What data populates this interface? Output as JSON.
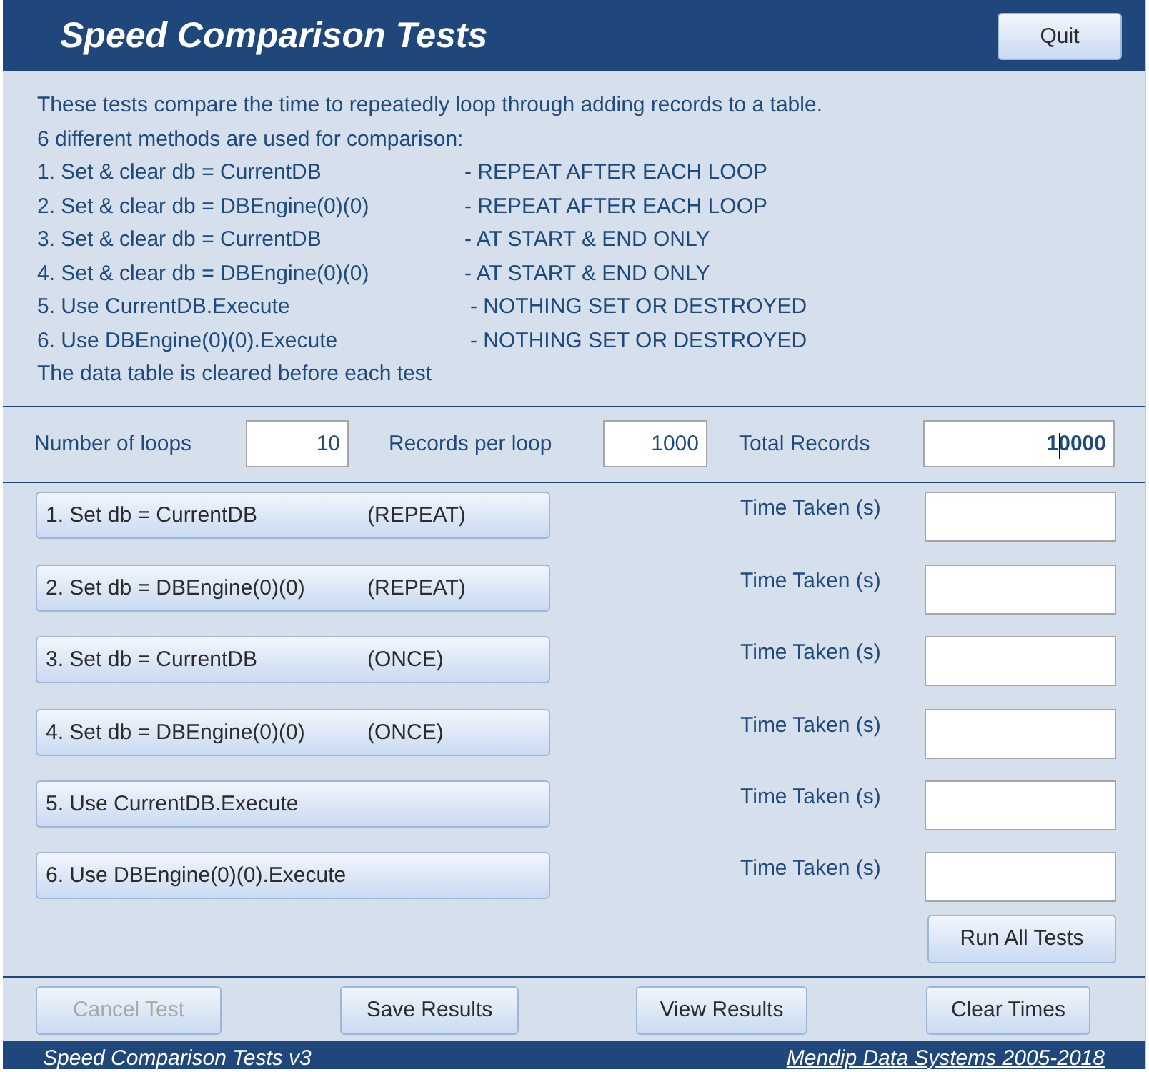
{
  "header": {
    "title": "Speed Comparison Tests",
    "quit_button": "Quit"
  },
  "intro": {
    "lines": [
      "These tests compare the time to repeatedly loop through adding records to a table.",
      "6 different methods are used for comparison:"
    ],
    "methods": [
      {
        "method": "1. Set & clear db = CurrentDB",
        "note": "- REPEAT AFTER EACH LOOP"
      },
      {
        "method": "2. Set & clear db = DBEngine(0)(0)",
        "note": "- REPEAT AFTER EACH LOOP"
      },
      {
        "method": "3. Set & clear db = CurrentDB",
        "note": "- AT START & END ONLY"
      },
      {
        "method": "4. Set & clear db = DBEngine(0)(0)",
        "note": "- AT START & END ONLY"
      },
      {
        "method": "5. Use CurrentDB.Execute",
        "note": "- NOTHING SET OR DESTROYED"
      },
      {
        "method": "6. Use DBEngine(0)(0).Execute",
        "note": "- NOTHING SET OR DESTROYED"
      }
    ],
    "footer_line": "The data table is cleared before each test"
  },
  "parameters": [
    {
      "label": "Number of loops",
      "value": "10",
      "focused": false
    },
    {
      "label": "Records per loop",
      "value": "1000",
      "focused": false
    },
    {
      "label": "Total Records",
      "value": "10000",
      "focused": true
    }
  ],
  "tests": [
    {
      "button": "1. Set db = CurrentDB",
      "mode": "(REPEAT)",
      "time_label": "Time Taken (s)"
    },
    {
      "button": "2. Set db = DBEngine(0)(0)",
      "mode": "(REPEAT)",
      "time_label": "Time Taken (s)"
    },
    {
      "button": "3. Set db = CurrentDB",
      "mode": "(ONCE)",
      "time_label": "Time Taken (s)"
    },
    {
      "button": "4. Set db = DBEngine(0)(0)",
      "mode": "(ONCE)",
      "time_label": "Time Taken (s)"
    },
    {
      "button": "5. Use CurrentDB.Execute",
      "time_label": "Time Taken (s)"
    },
    {
      "button": "6. Use DBEngine(0)(0).Execute",
      "time_label": "Time Taken (s)"
    }
  ],
  "run_all_button": "Run All Tests",
  "actions": [
    {
      "label": "Cancel Test",
      "disabled": true
    },
    {
      "label": "Save Results",
      "disabled": false
    },
    {
      "label": "View Results",
      "disabled": false
    },
    {
      "label": "Clear Times",
      "disabled": false
    }
  ],
  "status_bar": {
    "left": "Speed Comparison Tests v3",
    "right": "Mendip Data Systems 2005-2018"
  }
}
